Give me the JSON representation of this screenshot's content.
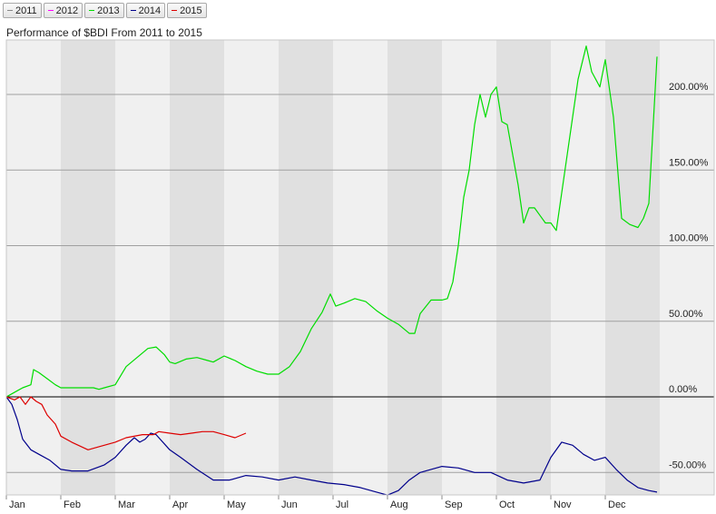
{
  "legend": [
    {
      "label": "2011",
      "color": "#888888"
    },
    {
      "label": "2012",
      "color": "#ff00ff"
    },
    {
      "label": "2013",
      "color": "#00dd00"
    },
    {
      "label": "2014",
      "color": "#00008b"
    },
    {
      "label": "2015",
      "color": "#dd0000"
    }
  ],
  "chart_data": {
    "type": "line",
    "title": "Performance of $BDI From 2011 to 2015",
    "x_months": [
      "Jan",
      "Feb",
      "Mar",
      "Apr",
      "May",
      "Jun",
      "Jul",
      "Aug",
      "Sep",
      "Oct",
      "Nov",
      "Dec"
    ],
    "ylim": [
      -65,
      235
    ],
    "y_ticks": [
      {
        "value": 200,
        "label": "200.00%"
      },
      {
        "value": 150,
        "label": "150.00%"
      },
      {
        "value": 100,
        "label": "100.00%"
      },
      {
        "value": 50,
        "label": "50.00%"
      },
      {
        "value": 0,
        "label": "0.00%"
      },
      {
        "value": -50,
        "label": "-50.00%"
      }
    ],
    "grid": true,
    "series": [
      {
        "name": "2013",
        "color": "#00dd00",
        "x": [
          0,
          0.1,
          0.2,
          0.3,
          0.45,
          0.5,
          0.6,
          0.75,
          0.9,
          1.0,
          1.2,
          1.4,
          1.6,
          1.7,
          1.8,
          2.0,
          2.2,
          2.4,
          2.6,
          2.75,
          2.9,
          3.0,
          3.1,
          3.3,
          3.5,
          3.7,
          3.8,
          4.0,
          4.2,
          4.4,
          4.6,
          4.8,
          5.0,
          5.2,
          5.4,
          5.6,
          5.8,
          5.95,
          6.05,
          6.2,
          6.4,
          6.6,
          6.8,
          7.0,
          7.2,
          7.4,
          7.5,
          7.6,
          7.8,
          8.0,
          8.1,
          8.2,
          8.3,
          8.4,
          8.5,
          8.6,
          8.7,
          8.8,
          8.9,
          9.0,
          9.1,
          9.2,
          9.3,
          9.4,
          9.5,
          9.6,
          9.7,
          9.8,
          9.9,
          10.0,
          10.1,
          10.3,
          10.5,
          10.65,
          10.75,
          10.9,
          11.0,
          11.15,
          11.3,
          11.45,
          11.6,
          11.7,
          11.8,
          11.95
        ],
        "y": [
          0,
          2,
          4,
          6,
          8,
          18,
          16,
          12,
          8,
          6,
          6,
          6,
          6,
          5,
          6,
          8,
          20,
          26,
          32,
          33,
          28,
          23,
          22,
          25,
          26,
          24,
          23,
          27,
          24,
          20,
          17,
          15,
          15,
          20,
          30,
          45,
          56,
          68,
          60,
          62,
          65,
          63,
          57,
          52,
          48,
          42,
          42,
          55,
          64,
          64,
          65,
          76,
          100,
          132,
          150,
          180,
          200,
          185,
          200,
          205,
          182,
          180,
          160,
          140,
          115,
          125,
          125,
          120,
          115,
          115,
          110,
          160,
          210,
          232,
          215,
          205,
          223,
          185,
          118,
          114,
          112,
          118,
          128,
          225
        ]
      },
      {
        "name": "2014",
        "color": "#00008b",
        "x": [
          0,
          0.1,
          0.2,
          0.3,
          0.45,
          0.6,
          0.8,
          1.0,
          1.2,
          1.5,
          1.8,
          2.0,
          2.2,
          2.35,
          2.45,
          2.55,
          2.65,
          2.75,
          3.0,
          3.2,
          3.5,
          3.8,
          4.1,
          4.4,
          4.7,
          5.0,
          5.3,
          5.6,
          5.9,
          6.2,
          6.5,
          6.8,
          7.0,
          7.2,
          7.4,
          7.6,
          7.8,
          8.0,
          8.3,
          8.6,
          8.9,
          9.2,
          9.5,
          9.8,
          10.0,
          10.2,
          10.4,
          10.6,
          10.8,
          11.0,
          11.2,
          11.4,
          11.6,
          11.8,
          11.95
        ],
        "y": [
          0,
          -5,
          -15,
          -28,
          -35,
          -38,
          -42,
          -48,
          -49,
          -49,
          -45,
          -40,
          -32,
          -27,
          -30,
          -28,
          -24,
          -25,
          -35,
          -40,
          -48,
          -55,
          -55,
          -52,
          -53,
          -55,
          -53,
          -55,
          -57,
          -58,
          -60,
          -63,
          -65,
          -62,
          -55,
          -50,
          -48,
          -46,
          -47,
          -50,
          -50,
          -55,
          -57,
          -55,
          -40,
          -30,
          -32,
          -38,
          -42,
          -40,
          -48,
          -55,
          -60,
          -62,
          -63
        ]
      },
      {
        "name": "2015",
        "color": "#dd0000",
        "x": [
          0,
          0.15,
          0.25,
          0.35,
          0.45,
          0.55,
          0.65,
          0.75,
          0.9,
          1.0,
          1.2,
          1.5,
          1.7,
          2.0,
          2.2,
          2.5,
          2.7,
          2.8,
          3.0,
          3.2,
          3.4,
          3.6,
          3.8,
          4.0,
          4.2,
          4.4
        ],
        "y": [
          0,
          -2,
          0,
          -5,
          0,
          -3,
          -5,
          -12,
          -18,
          -26,
          -30,
          -35,
          -33,
          -30,
          -27,
          -25,
          -25,
          -23,
          -24,
          -25,
          -24,
          -23,
          -23,
          -25,
          -27,
          -24
        ]
      }
    ]
  }
}
